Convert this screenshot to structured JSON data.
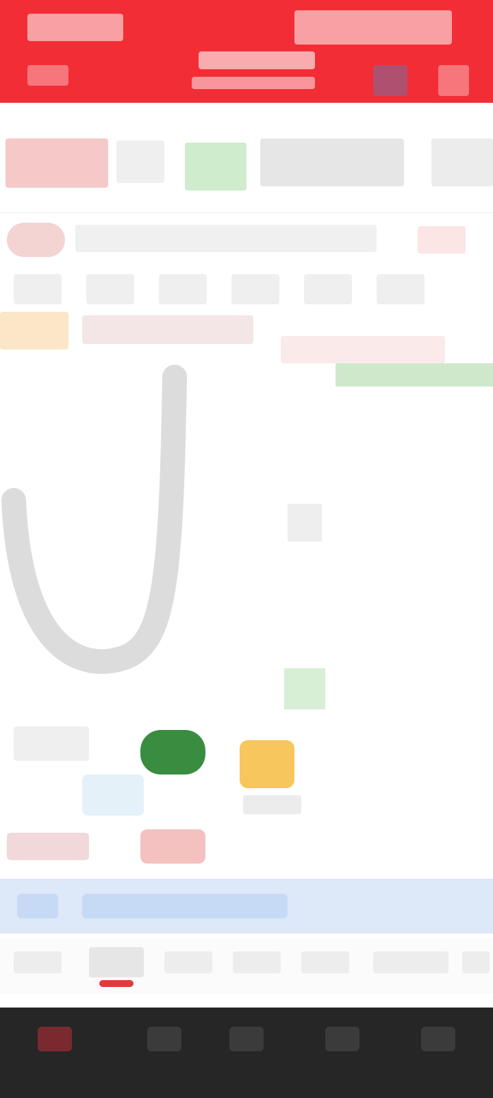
{
  "header": {
    "left_label": "",
    "title": "",
    "subtitle": "",
    "right_label": ""
  },
  "quote": {
    "price": "",
    "change": "",
    "change_pct": ""
  },
  "info": {
    "badge": "",
    "line": ""
  },
  "orderbook": {
    "rows": [
      {
        "price": "",
        "volume": ""
      },
      {
        "price": "",
        "volume": ""
      },
      {
        "price": "",
        "volume": ""
      },
      {
        "price": "",
        "volume": ""
      },
      {
        "price": "",
        "volume": ""
      },
      {
        "price": "",
        "volume": ""
      },
      {
        "price": "",
        "volume": ""
      },
      {
        "price": "",
        "volume": ""
      },
      {
        "price": "",
        "volume": ""
      },
      {
        "price": "",
        "volume": ""
      },
      {
        "price": "",
        "volume": ""
      },
      {
        "price": "",
        "volume": ""
      },
      {
        "price": "",
        "volume": ""
      },
      {
        "price": "",
        "volume": ""
      }
    ]
  },
  "blue_bar": {
    "text": ""
  },
  "tabs": [
    {
      "label": ""
    },
    {
      "label": ""
    },
    {
      "label": ""
    },
    {
      "label": ""
    },
    {
      "label": ""
    },
    {
      "label": ""
    },
    {
      "label": ""
    }
  ],
  "bottom_nav": [
    {
      "label": "",
      "active": true
    },
    {
      "label": "",
      "active": false
    },
    {
      "label": "",
      "active": false
    },
    {
      "label": "",
      "active": false
    },
    {
      "label": "",
      "active": false
    },
    {
      "label": "",
      "active": false
    }
  ],
  "colors": {
    "header_red": "#f22d36",
    "price_red": "#e83a3a",
    "up_green": "#39a63f",
    "nav_dark": "#262626",
    "panel_blue": "#dde8f8"
  }
}
